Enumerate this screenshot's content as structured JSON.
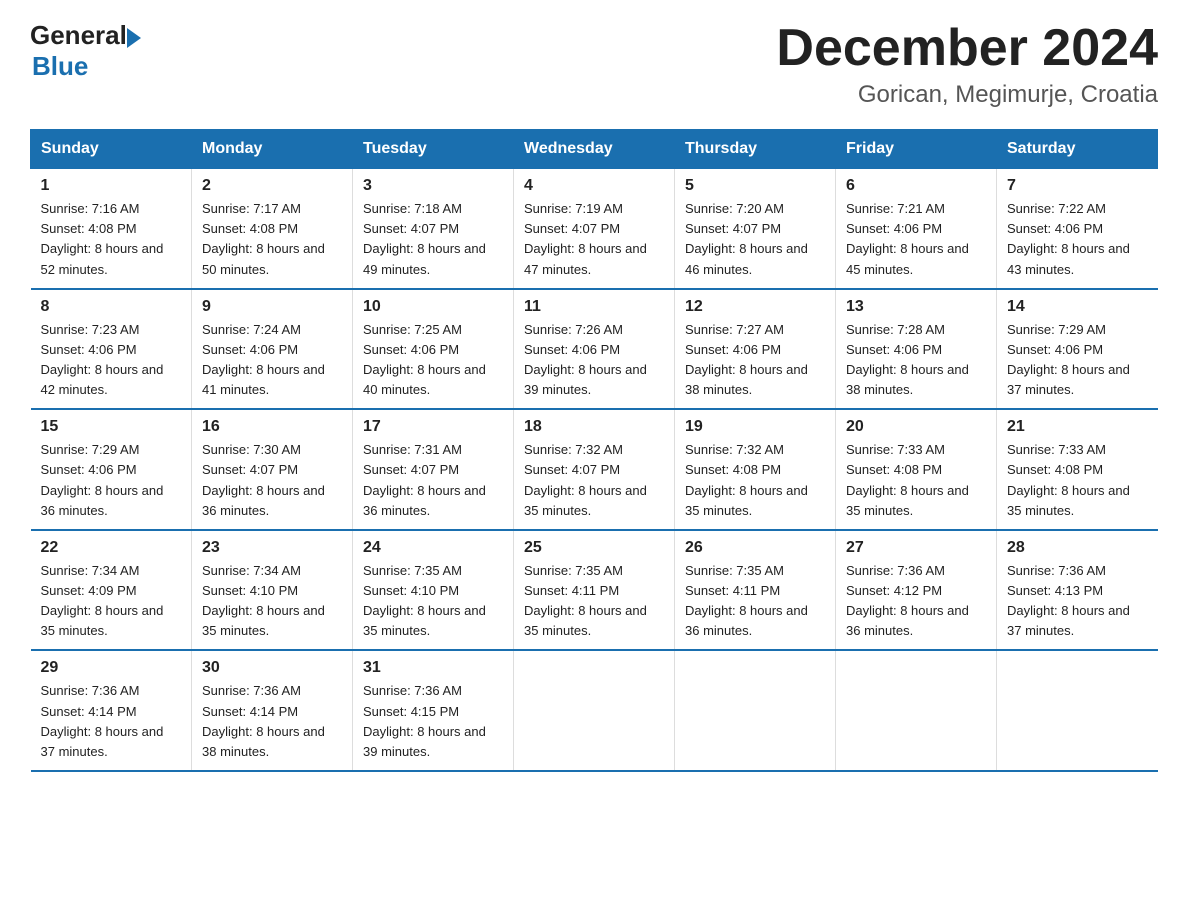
{
  "logo": {
    "text_general": "General",
    "text_blue": "Blue"
  },
  "header": {
    "month": "December 2024",
    "location": "Gorican, Megimurje, Croatia"
  },
  "days_of_week": [
    "Sunday",
    "Monday",
    "Tuesday",
    "Wednesday",
    "Thursday",
    "Friday",
    "Saturday"
  ],
  "weeks": [
    [
      {
        "day": "1",
        "sunrise": "7:16 AM",
        "sunset": "4:08 PM",
        "daylight": "8 hours and 52 minutes."
      },
      {
        "day": "2",
        "sunrise": "7:17 AM",
        "sunset": "4:08 PM",
        "daylight": "8 hours and 50 minutes."
      },
      {
        "day": "3",
        "sunrise": "7:18 AM",
        "sunset": "4:07 PM",
        "daylight": "8 hours and 49 minutes."
      },
      {
        "day": "4",
        "sunrise": "7:19 AM",
        "sunset": "4:07 PM",
        "daylight": "8 hours and 47 minutes."
      },
      {
        "day": "5",
        "sunrise": "7:20 AM",
        "sunset": "4:07 PM",
        "daylight": "8 hours and 46 minutes."
      },
      {
        "day": "6",
        "sunrise": "7:21 AM",
        "sunset": "4:06 PM",
        "daylight": "8 hours and 45 minutes."
      },
      {
        "day": "7",
        "sunrise": "7:22 AM",
        "sunset": "4:06 PM",
        "daylight": "8 hours and 43 minutes."
      }
    ],
    [
      {
        "day": "8",
        "sunrise": "7:23 AM",
        "sunset": "4:06 PM",
        "daylight": "8 hours and 42 minutes."
      },
      {
        "day": "9",
        "sunrise": "7:24 AM",
        "sunset": "4:06 PM",
        "daylight": "8 hours and 41 minutes."
      },
      {
        "day": "10",
        "sunrise": "7:25 AM",
        "sunset": "4:06 PM",
        "daylight": "8 hours and 40 minutes."
      },
      {
        "day": "11",
        "sunrise": "7:26 AM",
        "sunset": "4:06 PM",
        "daylight": "8 hours and 39 minutes."
      },
      {
        "day": "12",
        "sunrise": "7:27 AM",
        "sunset": "4:06 PM",
        "daylight": "8 hours and 38 minutes."
      },
      {
        "day": "13",
        "sunrise": "7:28 AM",
        "sunset": "4:06 PM",
        "daylight": "8 hours and 38 minutes."
      },
      {
        "day": "14",
        "sunrise": "7:29 AM",
        "sunset": "4:06 PM",
        "daylight": "8 hours and 37 minutes."
      }
    ],
    [
      {
        "day": "15",
        "sunrise": "7:29 AM",
        "sunset": "4:06 PM",
        "daylight": "8 hours and 36 minutes."
      },
      {
        "day": "16",
        "sunrise": "7:30 AM",
        "sunset": "4:07 PM",
        "daylight": "8 hours and 36 minutes."
      },
      {
        "day": "17",
        "sunrise": "7:31 AM",
        "sunset": "4:07 PM",
        "daylight": "8 hours and 36 minutes."
      },
      {
        "day": "18",
        "sunrise": "7:32 AM",
        "sunset": "4:07 PM",
        "daylight": "8 hours and 35 minutes."
      },
      {
        "day": "19",
        "sunrise": "7:32 AM",
        "sunset": "4:08 PM",
        "daylight": "8 hours and 35 minutes."
      },
      {
        "day": "20",
        "sunrise": "7:33 AM",
        "sunset": "4:08 PM",
        "daylight": "8 hours and 35 minutes."
      },
      {
        "day": "21",
        "sunrise": "7:33 AM",
        "sunset": "4:08 PM",
        "daylight": "8 hours and 35 minutes."
      }
    ],
    [
      {
        "day": "22",
        "sunrise": "7:34 AM",
        "sunset": "4:09 PM",
        "daylight": "8 hours and 35 minutes."
      },
      {
        "day": "23",
        "sunrise": "7:34 AM",
        "sunset": "4:10 PM",
        "daylight": "8 hours and 35 minutes."
      },
      {
        "day": "24",
        "sunrise": "7:35 AM",
        "sunset": "4:10 PM",
        "daylight": "8 hours and 35 minutes."
      },
      {
        "day": "25",
        "sunrise": "7:35 AM",
        "sunset": "4:11 PM",
        "daylight": "8 hours and 35 minutes."
      },
      {
        "day": "26",
        "sunrise": "7:35 AM",
        "sunset": "4:11 PM",
        "daylight": "8 hours and 36 minutes."
      },
      {
        "day": "27",
        "sunrise": "7:36 AM",
        "sunset": "4:12 PM",
        "daylight": "8 hours and 36 minutes."
      },
      {
        "day": "28",
        "sunrise": "7:36 AM",
        "sunset": "4:13 PM",
        "daylight": "8 hours and 37 minutes."
      }
    ],
    [
      {
        "day": "29",
        "sunrise": "7:36 AM",
        "sunset": "4:14 PM",
        "daylight": "8 hours and 37 minutes."
      },
      {
        "day": "30",
        "sunrise": "7:36 AM",
        "sunset": "4:14 PM",
        "daylight": "8 hours and 38 minutes."
      },
      {
        "day": "31",
        "sunrise": "7:36 AM",
        "sunset": "4:15 PM",
        "daylight": "8 hours and 39 minutes."
      },
      null,
      null,
      null,
      null
    ]
  ]
}
